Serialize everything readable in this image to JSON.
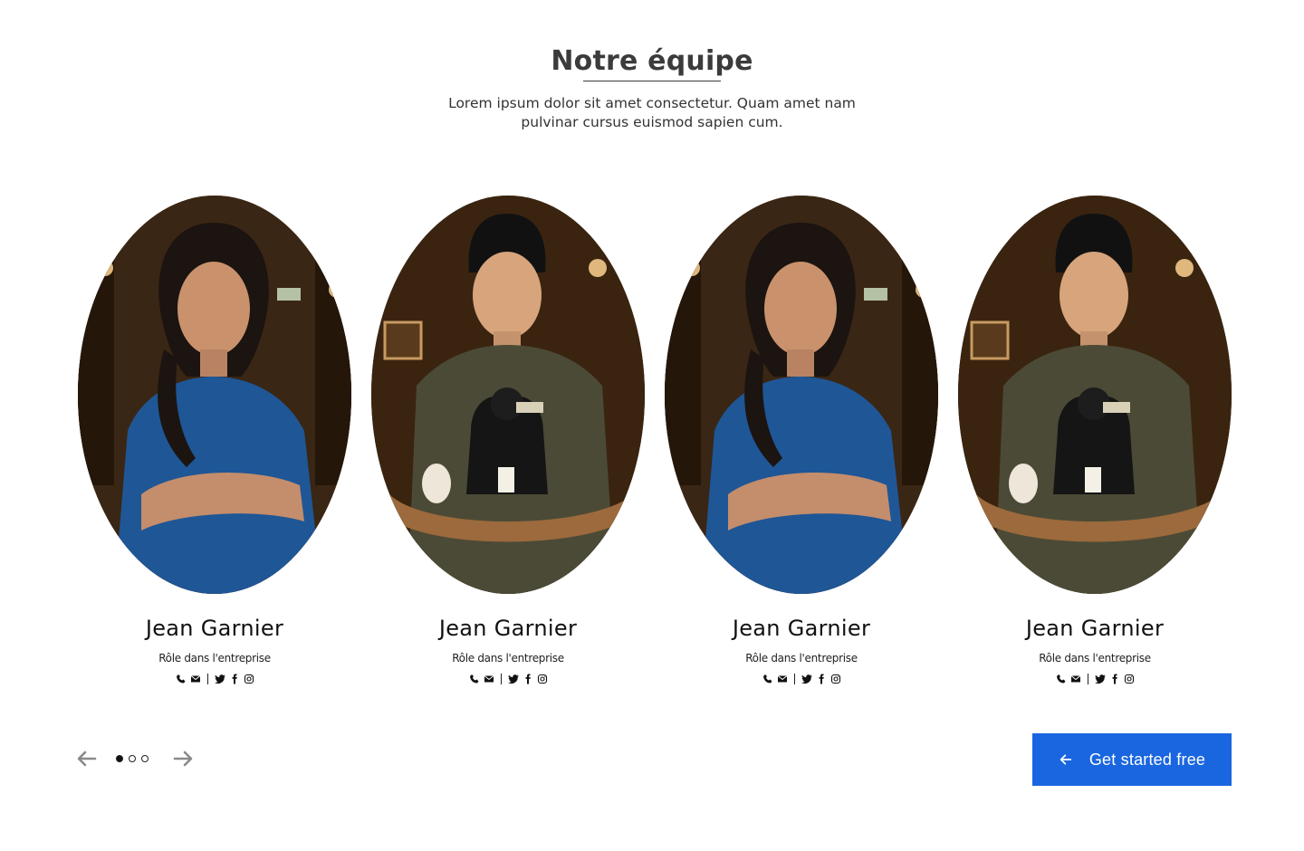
{
  "section": {
    "title": "Notre équipe",
    "subtitle": "Lorem ipsum dolor sit amet consectetur. Quam amet nam pulvinar cursus euismod sapien cum."
  },
  "team": [
    {
      "name": "Jean Garnier",
      "role": "Rôle dans l'entreprise",
      "photo": "woman-blue-uniform"
    },
    {
      "name": "Jean Garnier",
      "role": "Rôle dans l'entreprise",
      "photo": "man-olive-uniform-buddha-tray"
    },
    {
      "name": "Jean Garnier",
      "role": "Rôle dans l'entreprise",
      "photo": "woman-blue-uniform"
    },
    {
      "name": "Jean Garnier",
      "role": "Rôle dans l'entreprise",
      "photo": "man-olive-uniform-buddha-tray"
    }
  ],
  "social_icons": [
    "phone-icon",
    "mail-icon",
    "twitter-icon",
    "facebook-icon",
    "instagram-icon"
  ],
  "carousel": {
    "pages": 3,
    "active_index": 0
  },
  "cta": {
    "label": "Get started free"
  },
  "colors": {
    "accent": "#1a66e0",
    "title": "#3b3b3b"
  }
}
